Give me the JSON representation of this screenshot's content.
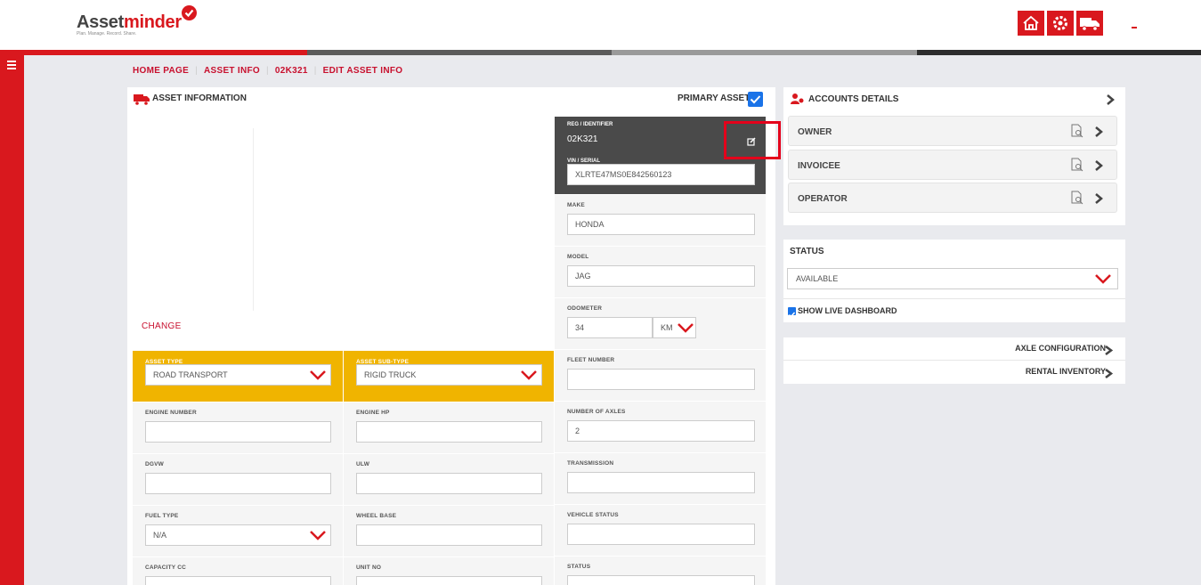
{
  "brand": {
    "name_part1": "Asset",
    "name_part2": "minder",
    "tagline": "Plan. Manage. Record. Share.",
    "accent_color": "#d9181e"
  },
  "header_icons": [
    "home-icon",
    "settings-gear-icon",
    "truck-icon"
  ],
  "breadcrumb": {
    "items": [
      "HOME PAGE",
      "ASSET INFO",
      "02K321",
      "EDIT ASSET INFO"
    ],
    "separator": "|"
  },
  "asset_info": {
    "title": "ASSET INFORMATION",
    "primary_label": "PRIMARY ASSET",
    "primary_checked": true,
    "change_label": "CHANGE"
  },
  "reg": {
    "label": "REG / IDENTIFIER",
    "value": "02K321",
    "vin_label": "VIN / SERIAL",
    "vin_value": "XLRTE47MS0E842560123"
  },
  "fields": {
    "make_label": "MAKE",
    "make_value": "HONDA",
    "model_label": "MODEL",
    "model_value": "JAG",
    "odometer_label": "ODOMETER",
    "odometer_value": "34",
    "odometer_unit": "KM",
    "asset_type_label": "ASSET TYPE",
    "asset_type_value": "ROAD TRANSPORT",
    "asset_subtype_label": "ASSET SUB-TYPE",
    "asset_subtype_value": "RIGID TRUCK",
    "fleet_number_label": "FLEET NUMBER",
    "fleet_number_value": "",
    "engine_number_label": "ENGINE NUMBER",
    "engine_number_value": "",
    "engine_hp_label": "ENGINE HP",
    "engine_hp_value": "",
    "axles_label": "NUMBER OF AXLES",
    "axles_value": "2",
    "dgvw_label": "DGVW",
    "dgvw_value": "",
    "ulw_label": "ULW",
    "ulw_value": "",
    "transmission_label": "TRANSMISSION",
    "transmission_value": "",
    "fuel_type_label": "FUEL TYPE",
    "fuel_type_value": "N/A",
    "wheel_base_label": "WHEEL BASE",
    "wheel_base_value": "",
    "vehicle_status_label": "VEHICLE STATUS",
    "vehicle_status_value": "",
    "capacity_label": "CAPACITY CC",
    "unit_no_label": "UNIT NO",
    "status_label": "STATUS"
  },
  "accounts": {
    "title": "ACCOUNTS DETAILS",
    "rows": [
      "OWNER",
      "INVOICEE",
      "OPERATOR"
    ]
  },
  "status_panel": {
    "title": "STATUS",
    "value": "AVAILABLE",
    "live_label": "SHOW LIVE DASHBOARD",
    "live_checked": true
  },
  "extra": {
    "axle_config": "AXLE CONFIGURATION",
    "rental_inventory": "RENTAL INVENTORY"
  }
}
